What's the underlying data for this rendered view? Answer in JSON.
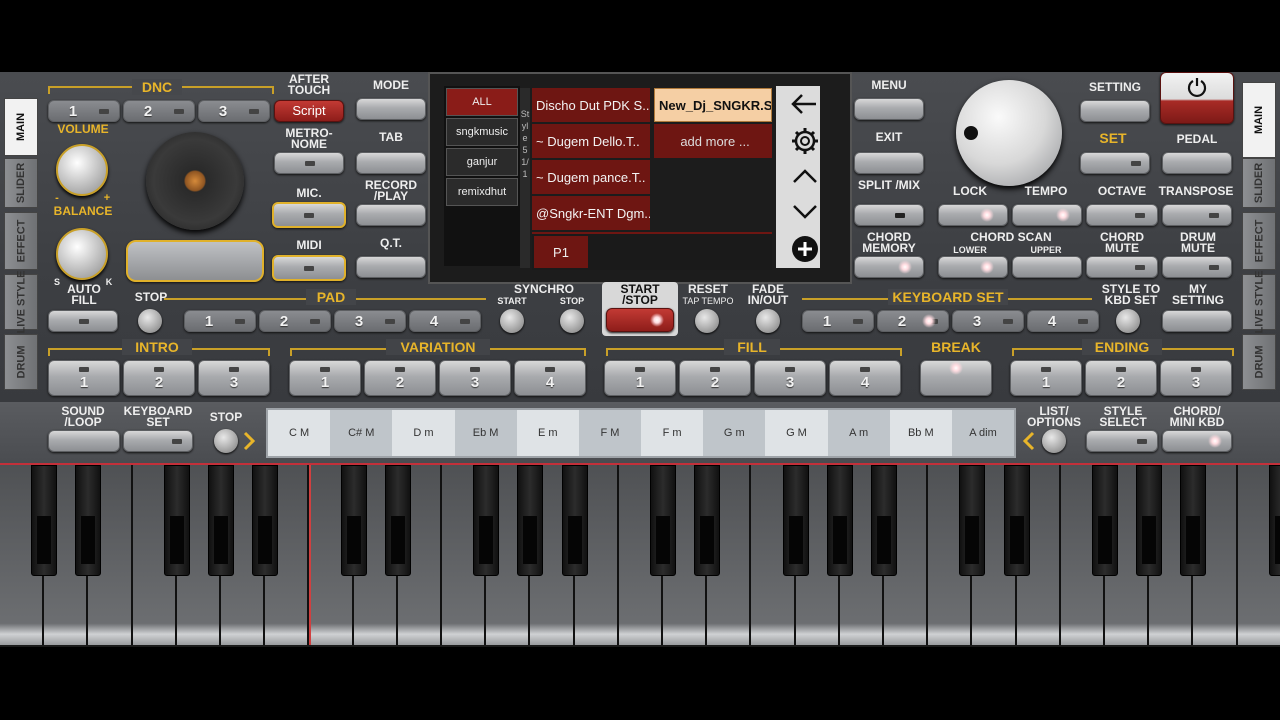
{
  "side_tabs_left": [
    "MAIN",
    "SLIDER",
    "EFFECT",
    "LIVE STYLE",
    "DRUM"
  ],
  "side_tabs_right": [
    "MAIN",
    "SLIDER",
    "EFFECT",
    "LIVE STYLE",
    "DRUM"
  ],
  "dnc": {
    "title": "DNC",
    "buttons": [
      "1",
      "2",
      "3"
    ],
    "after_touch": "AFTER TOUCH",
    "script": "Script"
  },
  "volume": "VOLUME",
  "balance": "BALANCE",
  "balance_minus": "-",
  "balance_plus": "+",
  "balance_s": "S",
  "balance_k": "K",
  "metronome": "METRO- NOME",
  "mic": "MIC.",
  "midi": "MIDI",
  "center_left": {
    "mode": "MODE",
    "tab": "TAB",
    "record": "RECORD /PLAY",
    "qt": "Q.T."
  },
  "screen": {
    "categories": [
      "ALL",
      "sngkmusic",
      "ganjur",
      "remixdhut"
    ],
    "vertical_label": "Style 5 1/1",
    "styles": [
      "Discho Dut PDK S..",
      "~ Dugem  Dello.T..",
      "~ Dugem pance.T..",
      "@Sngkr-ENT Dgm.."
    ],
    "selected_style": "New_Dj_SNGKR.S..",
    "add_more": "add more ...",
    "page": "P1"
  },
  "center_right": {
    "menu": "MENU",
    "exit": "EXIT",
    "split": "SPLIT /MIX",
    "chord_memory": "CHORD MEMORY"
  },
  "right": {
    "setting": "SETTING",
    "set": "SET",
    "pedal": "PEDAL",
    "lock": "LOCK",
    "tempo": "TEMPO",
    "octave": "OCTAVE",
    "transpose": "TRANSPOSE",
    "chord_scan": "CHORD SCAN",
    "lower": "LOWER",
    "upper": "UPPER",
    "chord_mute": "CHORD MUTE",
    "drum_mute": "DRUM MUTE"
  },
  "row2": {
    "auto_fill": "AUTO FILL",
    "stop": "STOP",
    "pad": "PAD",
    "pad_buttons": [
      "1",
      "2",
      "3",
      "4"
    ],
    "synchro": "SYNCHRO",
    "synchro_start": "START",
    "synchro_stop": "STOP",
    "start_stop": "START /STOP",
    "reset": "RESET",
    "tap_tempo": "TAP TEMPO",
    "fade": "FADE IN/OUT",
    "keyboard_set": "KEYBOARD SET",
    "kbd_buttons": [
      "1",
      "2",
      "3",
      "4"
    ],
    "style_to_kbd": "STYLE TO KBD SET",
    "my_setting": "MY SETTING"
  },
  "sections": {
    "intro": {
      "label": "INTRO",
      "buttons": [
        "1",
        "2",
        "3"
      ]
    },
    "variation": {
      "label": "VARIATION",
      "buttons": [
        "1",
        "2",
        "3",
        "4"
      ]
    },
    "fill": {
      "label": "FILL",
      "buttons": [
        "1",
        "2",
        "3",
        "4"
      ]
    },
    "break": {
      "label": "BREAK"
    },
    "ending": {
      "label": "ENDING",
      "buttons": [
        "1",
        "2",
        "3"
      ]
    }
  },
  "bottom": {
    "sound_loop": "SOUND /LOOP",
    "keyboard_set": "KEYBOARD SET",
    "stop": "STOP",
    "chords": [
      "C M",
      "C# M",
      "D m",
      "Eb M",
      "E m",
      "F M",
      "F m",
      "G m",
      "G M",
      "A m",
      "Bb M",
      "A dim"
    ],
    "list_options": "LIST/ OPTIONS",
    "style_select": "STYLE SELECT",
    "chord_mini": "CHORD/ MINI KBD"
  },
  "colors": {
    "accent": "#e8b52a",
    "red": "#8e1d1a",
    "panel": "#3d3f43"
  }
}
